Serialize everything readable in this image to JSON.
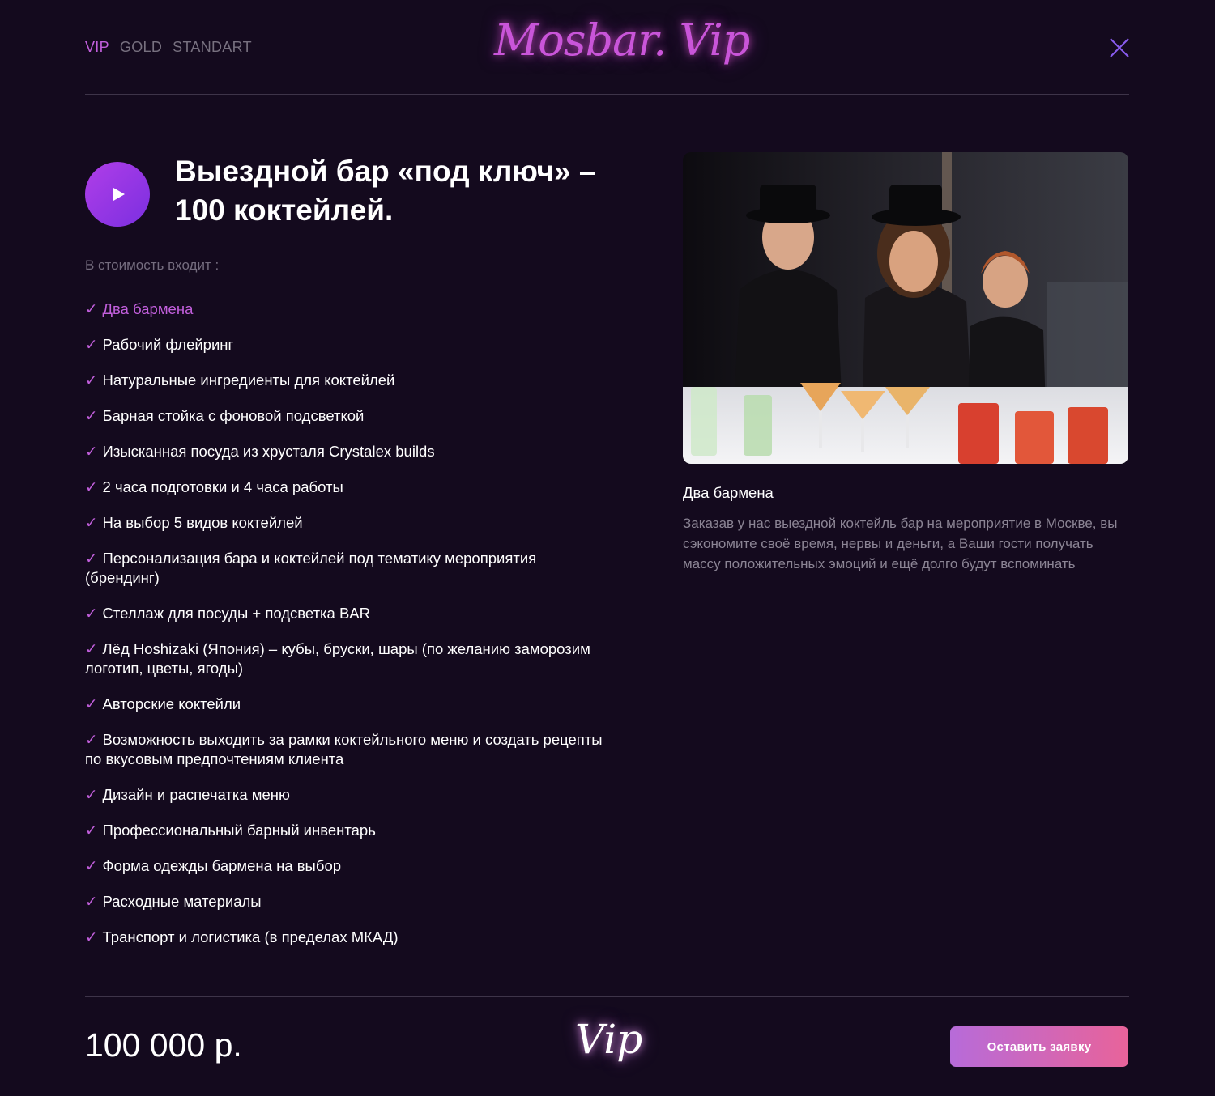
{
  "header": {
    "tabs": [
      {
        "label": "VIP",
        "active": true
      },
      {
        "label": "GOLD",
        "active": false
      },
      {
        "label": "STANDART",
        "active": false
      }
    ],
    "logo_text": "Mosbar. Vip",
    "close_icon": "close-icon"
  },
  "main": {
    "title": "Выездной бар «под ключ» – 100 коктейлей.",
    "includes_label": "В стоимость входит :",
    "check_mark": "✓",
    "features": [
      "Два бармена",
      "Рабочий флейринг",
      "Натуральные ингредиенты для коктейлей",
      "Барная стойка с фоновой подсветкой",
      "Изысканная посуда из хрусталя Crystalex builds",
      "2 часа подготовки и 4 часа работы",
      "На выбор 5 видов коктейлей",
      "Персонализация бара и коктейлей под тематику мероприятия (брендинг)",
      "Стеллаж для посуды + подсветка BAR",
      "Лёд Hoshizaki (Япония) – кубы, бруски, шары (по желанию заморозим логотип, цветы, ягоды)",
      "Авторские коктейли",
      "Возможность выходить за рамки коктейльного меню и создать рецепты по вкусовым предпочтениям клиента",
      "Дизайн и распечатка меню",
      "Профессиональный барный инвентарь",
      "Форма одежды бармена на выбор",
      "Расходные материалы",
      "Транспорт и логистика (в пределах МКАД)"
    ],
    "highlighted_feature_index": 0
  },
  "side": {
    "caption": "Два бармена",
    "description": "Заказав у нас выездной коктейль бар на мероприятие в Москве, вы сэкономите своё время, нервы и деньги, а Ваши гости получать массу положительных эмоций и ещё долго будут вспоминать"
  },
  "footer": {
    "price": "100 000 р.",
    "vip_mark": "Vip",
    "cta_label": "Оставить заявку"
  },
  "colors": {
    "background": "#140a1e",
    "accent": "#c25fdc",
    "muted": "#77707f",
    "cta_start": "#b76bd9",
    "cta_end": "#e8639a"
  }
}
